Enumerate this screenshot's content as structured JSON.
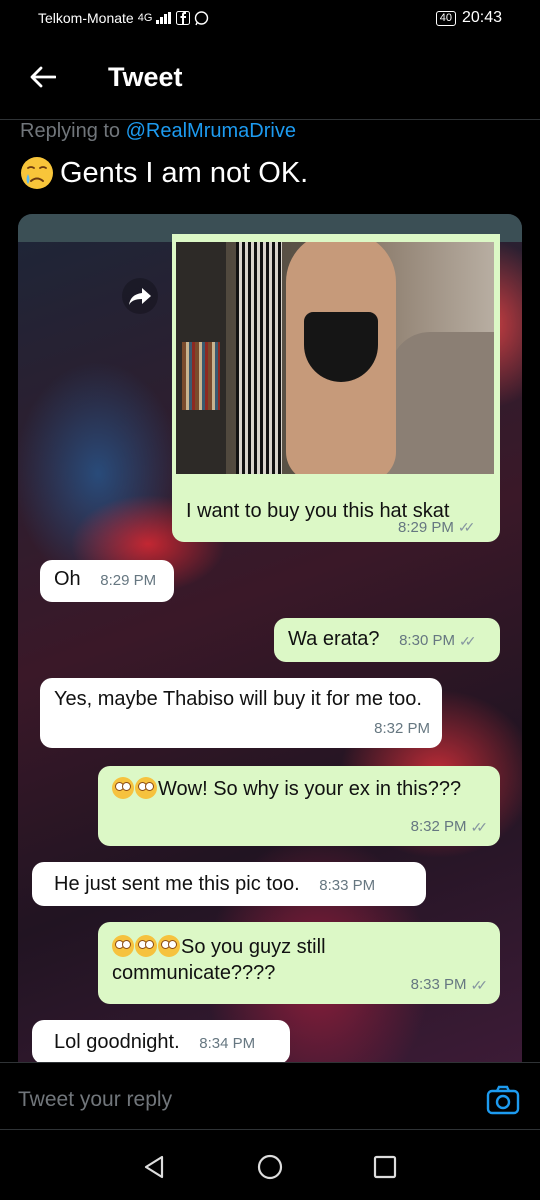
{
  "status_bar": {
    "carrier": "Telkom-Monate",
    "network": "4G",
    "battery": "40",
    "time": "20:43"
  },
  "header": {
    "title": "Tweet",
    "back_icon": "arrow-left-icon"
  },
  "tweet": {
    "replying_prefix": "Replying to",
    "replying_handle": "@RealMrumaDrive",
    "text_emoji": "crying-face-emoji",
    "text": "Gents I am not OK."
  },
  "chat": {
    "messages": [
      {
        "side": "out",
        "text": "I want to buy you this hat skat",
        "time": "8:29 PM",
        "ticks": "✓✓"
      },
      {
        "side": "in",
        "text": "Oh",
        "time": "8:29 PM"
      },
      {
        "side": "out",
        "text": "Wa erata?",
        "time": "8:30 PM",
        "ticks": "✓✓"
      },
      {
        "side": "in",
        "text": "Yes, maybe Thabiso will buy it for me too.",
        "time": "8:32 PM"
      },
      {
        "side": "out",
        "text": "Wow! So why is your ex in this???",
        "time": "8:32 PM",
        "ticks": "✓✓"
      },
      {
        "side": "in",
        "text": "He just sent me this pic too.",
        "time": "8:33 PM"
      },
      {
        "side": "out",
        "text": "So you guyz still communicate????",
        "time": "8:33 PM",
        "ticks": "✓✓"
      },
      {
        "side": "in",
        "text": "Lol goodnight.",
        "time": "8:34 PM"
      }
    ]
  },
  "reply_bar": {
    "placeholder": "Tweet your reply"
  },
  "colors": {
    "accent": "#1d9bf0",
    "outgoing_bubble": "#dcf8c6",
    "incoming_bubble": "#ffffff",
    "muted_text": "#71767b"
  }
}
